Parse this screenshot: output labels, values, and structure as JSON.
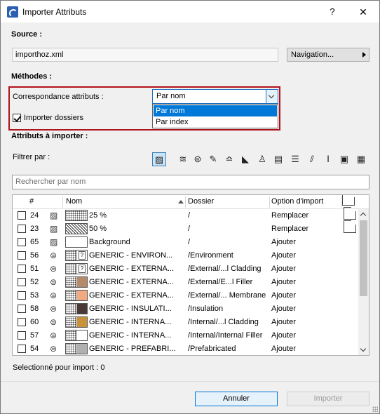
{
  "window": {
    "title": "Importer Attributs",
    "help": "?",
    "close": "✕"
  },
  "source": {
    "heading": "Source :",
    "file": "importhoz.xml",
    "nav_button": "Navigation..."
  },
  "methods": {
    "heading": "Méthodes :",
    "match_label": "Correspondance attributs :",
    "match_value": "Par nom",
    "options": [
      "Par nom",
      "Par index"
    ],
    "import_folders_label": "Importer dossiers",
    "import_folders_checked": true
  },
  "attributes": {
    "heading": "Attributs à importer :",
    "filter_label": "Filtrer par :",
    "search_placeholder": "Rechercher par nom",
    "columns": {
      "num": "#",
      "name": "Nom",
      "folder": "Dossier",
      "option": "Option d'import"
    },
    "rows": [
      {
        "num": "24",
        "tool": "fill",
        "swatch": "dots",
        "name": "25 %",
        "folder": "/",
        "option": "Remplacer",
        "roof": true
      },
      {
        "num": "23",
        "tool": "fill",
        "swatch": "cross",
        "name": "50 %",
        "folder": "/",
        "option": "Remplacer",
        "roof": true
      },
      {
        "num": "65",
        "tool": "fill",
        "swatch": "blank",
        "name": "Background",
        "folder": "/",
        "option": "Ajouter",
        "roof": false
      },
      {
        "num": "56",
        "tool": "composite",
        "swatch": "?",
        "color": "",
        "name": "GENERIC - ENVIRON...",
        "folder": "/Environment",
        "option": "Ajouter",
        "roof": false
      },
      {
        "num": "51",
        "tool": "composite",
        "swatch": "?",
        "color": "",
        "name": "GENERIC - EXTERNA...",
        "folder": "/External/...l Cladding",
        "option": "Ajouter",
        "roof": false
      },
      {
        "num": "52",
        "tool": "composite",
        "swatch": "color",
        "color": "#b58a6a",
        "name": "GENERIC - EXTERNA...",
        "folder": "/External/E...l Filler",
        "option": "Ajouter",
        "roof": false
      },
      {
        "num": "53",
        "tool": "composite",
        "swatch": "color",
        "color": "#f1a982",
        "name": "GENERIC - EXTERNA...",
        "folder": "/External/... Membrane",
        "option": "Ajouter",
        "roof": false
      },
      {
        "num": "58",
        "tool": "composite",
        "swatch": "color",
        "color": "#4a3a36",
        "name": "GENERIC - INSULATI...",
        "folder": "/Insulation",
        "option": "Ajouter",
        "roof": false
      },
      {
        "num": "60",
        "tool": "composite",
        "swatch": "color",
        "color": "#c8913a",
        "name": "GENERIC - INTERNA...",
        "folder": "/Internal/...l Cladding",
        "option": "Ajouter",
        "roof": false
      },
      {
        "num": "57",
        "tool": "composite",
        "swatch": "color",
        "color": "#ffffff",
        "name": "GENERIC - INTERNA...",
        "folder": "/Internal/Internal Filler",
        "option": "Ajouter",
        "roof": false
      },
      {
        "num": "54",
        "tool": "composite",
        "swatch": "color",
        "color": "#b0b0b0",
        "name": "GENERIC - PREFABRI...",
        "folder": "/Prefabricated",
        "option": "Ajouter",
        "roof": false
      }
    ],
    "selected_count_label": "Selectionné pour import : 0"
  },
  "filter_icons": [
    "fill-type-icon",
    "line-type-icon",
    "composite-icon",
    "pen-icon",
    "zone-icon",
    "profile-icon",
    "material-icon",
    "building-material-icon",
    "layer-icon",
    "marker-icon",
    "dimension-icon",
    "surface-icon",
    "mep-icon",
    "table-icon"
  ],
  "buttons": {
    "cancel": "Annuler",
    "import": "Importer"
  },
  "colors": {
    "highlight_border": "#b0121b",
    "selection": "#0078d7"
  }
}
